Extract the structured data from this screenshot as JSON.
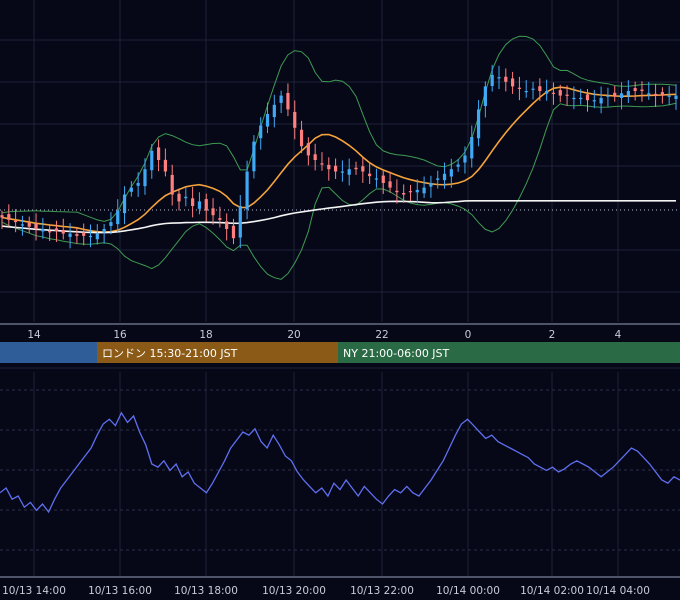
{
  "colors": {
    "background": "#060818",
    "grid": "#1f2236",
    "grid_dashed": "#2c2f45",
    "candle_up": "#3fa9f5",
    "candle_down": "#ff7f7f",
    "bollinger": "#3f9b52",
    "ma_orange": "#f5a33a",
    "ma_white": "#f4f4f4",
    "oscillator": "#5f6ff0",
    "axis_divider": "#9aa0b8",
    "session_tokyo": "#2e5d97",
    "session_london": "#8a5a16",
    "session_ny": "#2a6b45"
  },
  "sessions": [
    {
      "label": "",
      "color_key": "session_tokyo"
    },
    {
      "label": "ロンドン 15:30-21:00 JST",
      "color_key": "session_london"
    },
    {
      "label": "NY 21:00-06:00 JST",
      "color_key": "session_ny"
    }
  ],
  "chart_data": [
    {
      "type": "candlestick",
      "title": "",
      "x_ticks": [
        "14",
        "16",
        "18",
        "20",
        "22",
        "0",
        "2",
        "4"
      ],
      "price_line": "dotted horizontal reference line",
      "grid": true,
      "candles_close": [
        0.35,
        0.34,
        0.33,
        0.32,
        0.31,
        0.3,
        0.3,
        0.29,
        0.29,
        0.28,
        0.28,
        0.27,
        0.27,
        0.27,
        0.28,
        0.3,
        0.33,
        0.38,
        0.45,
        0.48,
        0.5,
        0.56,
        0.64,
        0.6,
        0.55,
        0.45,
        0.42,
        0.44,
        0.4,
        0.42,
        0.38,
        0.36,
        0.34,
        0.3,
        0.26,
        0.4,
        0.55,
        0.68,
        0.75,
        0.8,
        0.84,
        0.88,
        0.82,
        0.74,
        0.66,
        0.62,
        0.6,
        0.58,
        0.56,
        0.55,
        0.55,
        0.56,
        0.56,
        0.55,
        0.53,
        0.52,
        0.5,
        0.48,
        0.46,
        0.45,
        0.46,
        0.47,
        0.48,
        0.5,
        0.52,
        0.54,
        0.56,
        0.58,
        0.62,
        0.7,
        0.82,
        0.92,
        0.97,
        0.96,
        0.94,
        0.92,
        0.91,
        0.9,
        0.91,
        0.9,
        0.9,
        0.89,
        0.88,
        0.88,
        0.87,
        0.87,
        0.86,
        0.86,
        0.87,
        0.88,
        0.88,
        0.89,
        0.9,
        0.9,
        0.9,
        0.89,
        0.88,
        0.88,
        0.88,
        0.88
      ],
      "series": [
        {
          "name": "",
          "style": "bollinger_upper",
          "color_key": "bollinger"
        },
        {
          "name": "",
          "style": "bollinger_lower",
          "color_key": "bollinger"
        },
        {
          "name": "",
          "style": "moving_average",
          "color_key": "ma_orange"
        },
        {
          "name": "",
          "style": "moving_average",
          "color_key": "ma_white"
        }
      ]
    },
    {
      "type": "line",
      "title": "",
      "x_ticks": [
        "10/13 14:00",
        "10/13 16:00",
        "10/13 18:00",
        "10/13 20:00",
        "10/13 22:00",
        "10/14 00:00",
        "10/14 02:00",
        "10/14 04:00"
      ],
      "values": [
        0.42,
        0.45,
        0.38,
        0.4,
        0.33,
        0.36,
        0.31,
        0.35,
        0.3,
        0.38,
        0.45,
        0.5,
        0.55,
        0.6,
        0.65,
        0.7,
        0.78,
        0.85,
        0.88,
        0.84,
        0.92,
        0.86,
        0.9,
        0.8,
        0.72,
        0.6,
        0.58,
        0.62,
        0.56,
        0.6,
        0.52,
        0.55,
        0.48,
        0.45,
        0.42,
        0.48,
        0.55,
        0.62,
        0.7,
        0.75,
        0.8,
        0.78,
        0.82,
        0.74,
        0.7,
        0.78,
        0.72,
        0.65,
        0.62,
        0.55,
        0.5,
        0.46,
        0.42,
        0.45,
        0.4,
        0.48,
        0.44,
        0.5,
        0.45,
        0.4,
        0.46,
        0.42,
        0.38,
        0.35,
        0.4,
        0.44,
        0.42,
        0.46,
        0.42,
        0.4,
        0.45,
        0.5,
        0.56,
        0.62,
        0.7,
        0.78,
        0.85,
        0.88,
        0.84,
        0.8,
        0.76,
        0.78,
        0.74,
        0.72,
        0.7,
        0.68,
        0.66,
        0.64,
        0.6,
        0.58,
        0.56,
        0.58,
        0.55,
        0.57,
        0.6,
        0.62,
        0.6,
        0.58,
        0.55,
        0.52,
        0.55,
        0.58,
        0.62,
        0.66,
        0.7,
        0.68,
        0.64,
        0.6,
        0.55,
        0.5,
        0.48,
        0.52,
        0.5
      ],
      "grid": true
    }
  ]
}
